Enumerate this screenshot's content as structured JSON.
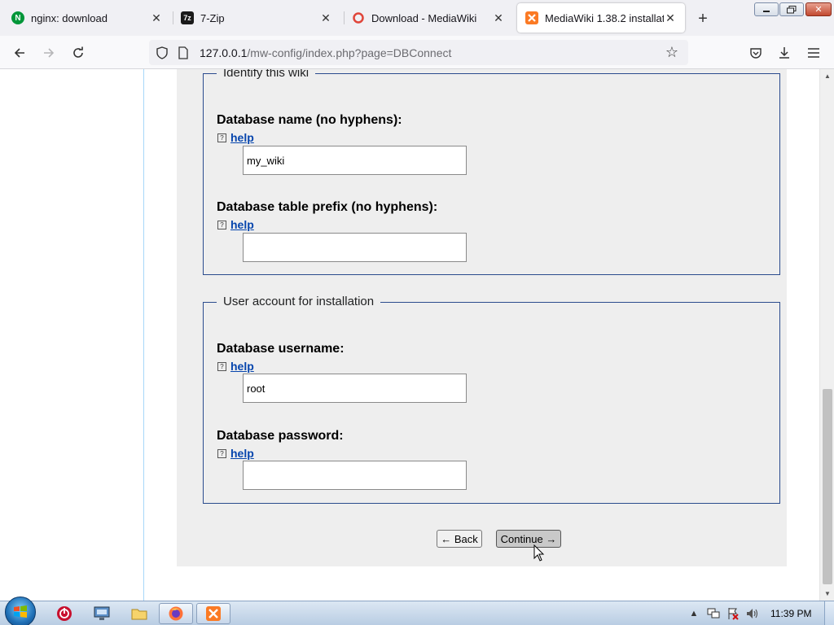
{
  "browser": {
    "tabs": [
      {
        "title": "nginx: download",
        "favicon_letter": "N",
        "favicon_color": "#009639",
        "active": false
      },
      {
        "title": "7-Zip",
        "favicon_letter": "7z",
        "favicon_color": "#1a1a1a",
        "active": false
      },
      {
        "title": "Download - MediaWiki",
        "favicon_letter": "",
        "favicon_color": "#e0453a",
        "active": false
      },
      {
        "title": "MediaWiki 1.38.2 installation",
        "favicon_letter": "",
        "favicon_color": "#fb7a24",
        "active": true
      }
    ],
    "new_tab": "+",
    "url_host": "127.0.0.1",
    "url_path": "/mw-config/index.php?page=DBConnect"
  },
  "form": {
    "identify_legend": "Identify this wiki",
    "db_name_label": "Database name (no hyphens):",
    "db_name_value": "my_wiki",
    "db_prefix_label": "Database table prefix (no hyphens):",
    "db_prefix_value": "",
    "user_legend": "User account for installation",
    "db_user_label": "Database username:",
    "db_user_value": "root",
    "db_pass_label": "Database password:",
    "db_pass_value": "",
    "help_text": "help",
    "help_icon": "?",
    "back_label": "← Back",
    "continue_label": "Continue →"
  },
  "taskbar": {
    "clock": "11:39 PM"
  },
  "icons": {
    "back": "arrow-left-icon",
    "forward": "arrow-right-icon",
    "reload": "reload-icon",
    "bookmark": "star-icon",
    "pocket": "pocket-icon",
    "downloads": "download-icon",
    "menu": "hamburger-menu-icon"
  }
}
